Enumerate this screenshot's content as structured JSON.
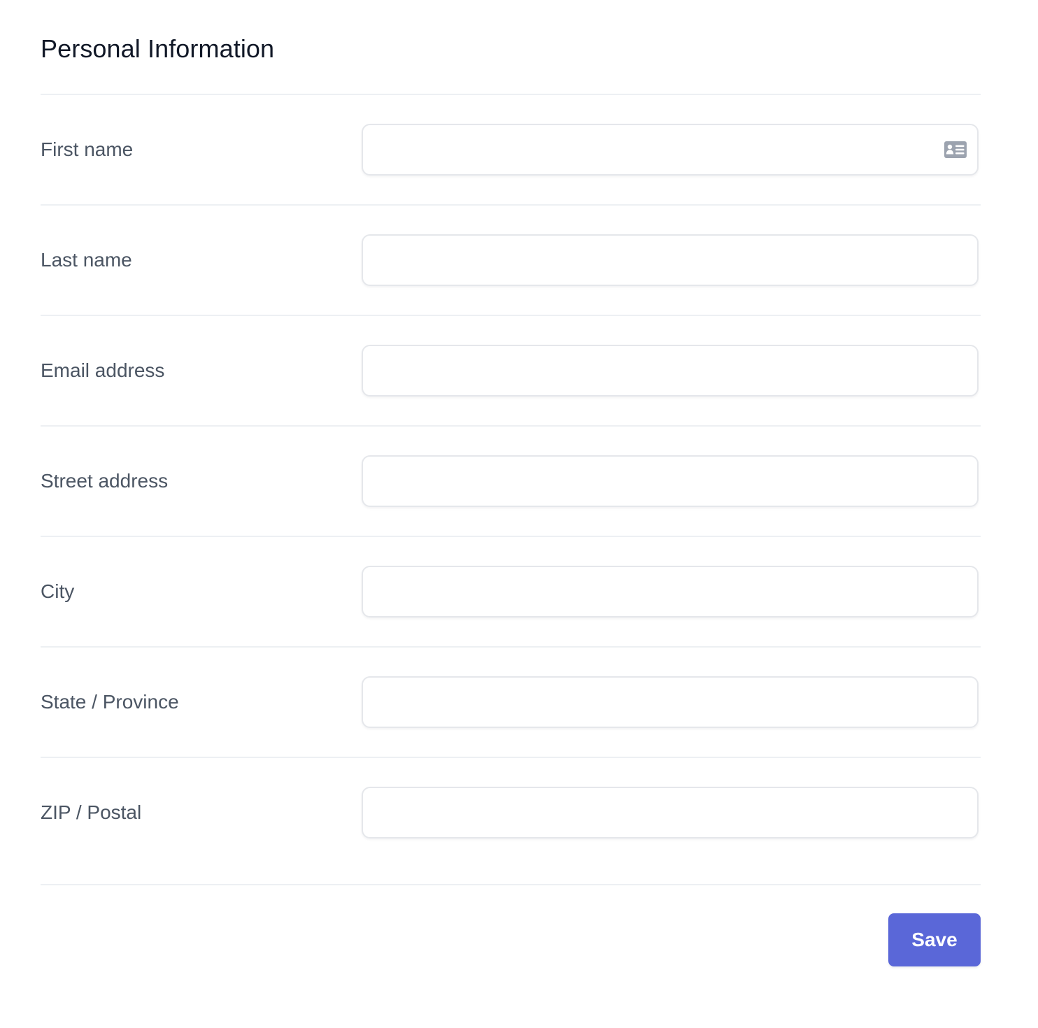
{
  "form": {
    "title": "Personal Information",
    "fields": [
      {
        "label": "First name",
        "value": "",
        "icon": "contact-card-icon"
      },
      {
        "label": "Last name",
        "value": ""
      },
      {
        "label": "Email address",
        "value": ""
      },
      {
        "label": "Street address",
        "value": ""
      },
      {
        "label": "City",
        "value": ""
      },
      {
        "label": "State / Province",
        "value": ""
      },
      {
        "label": "ZIP / Postal",
        "value": ""
      }
    ],
    "save_label": "Save"
  },
  "colors": {
    "accent": "#5a67d8",
    "label": "#4b5563",
    "title": "#111827",
    "divider": "#edf0f3",
    "input_border": "#e5e7eb",
    "icon": "#9ca3af"
  }
}
